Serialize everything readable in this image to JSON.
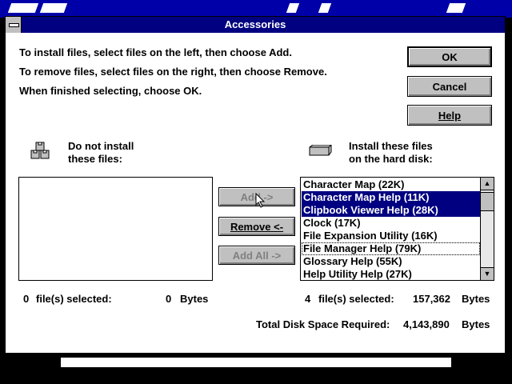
{
  "dialog": {
    "title": "Accessories",
    "instructions": [
      "To install files, select files on the left, then choose Add.",
      "To remove files, select files on the right, then choose Remove.",
      "When finished selecting, choose OK."
    ],
    "buttons": {
      "ok": "OK",
      "cancel": "Cancel",
      "help": "Help"
    }
  },
  "left": {
    "label_line1": "Do not install",
    "label_line2": "these files:",
    "status_count": "0",
    "status_text": "file(s) selected:",
    "status_bytes": "0",
    "bytes_unit": "Bytes"
  },
  "right": {
    "label_line1": "Install these files",
    "label_line2": "on the hard disk:",
    "items": [
      {
        "label": "Character Map (22K)",
        "selected": false
      },
      {
        "label": "Character Map Help (11K)",
        "selected": true
      },
      {
        "label": "Clipbook Viewer Help (28K)",
        "selected": true
      },
      {
        "label": "Clock (17K)",
        "selected": false
      },
      {
        "label": "File Expansion Utility (16K)",
        "selected": false
      },
      {
        "label": "File Manager Help (79K)",
        "selected": false,
        "focused": true
      },
      {
        "label": "Glossary Help (55K)",
        "selected": false
      },
      {
        "label": "Help Utility Help (27K)",
        "selected": false
      }
    ],
    "status_count": "4",
    "status_text": "file(s) selected:",
    "status_bytes": "157,362",
    "bytes_unit": "Bytes"
  },
  "middle_buttons": {
    "add": "Add ->",
    "remove": "Remove  <-",
    "add_all": "Add All ->"
  },
  "total": {
    "label": "Total Disk Space Required:",
    "value": "4,143,890",
    "unit": "Bytes"
  },
  "colors": {
    "titlebar": "#000080",
    "selection": "#000080",
    "button_face": "#c0c0c0"
  }
}
